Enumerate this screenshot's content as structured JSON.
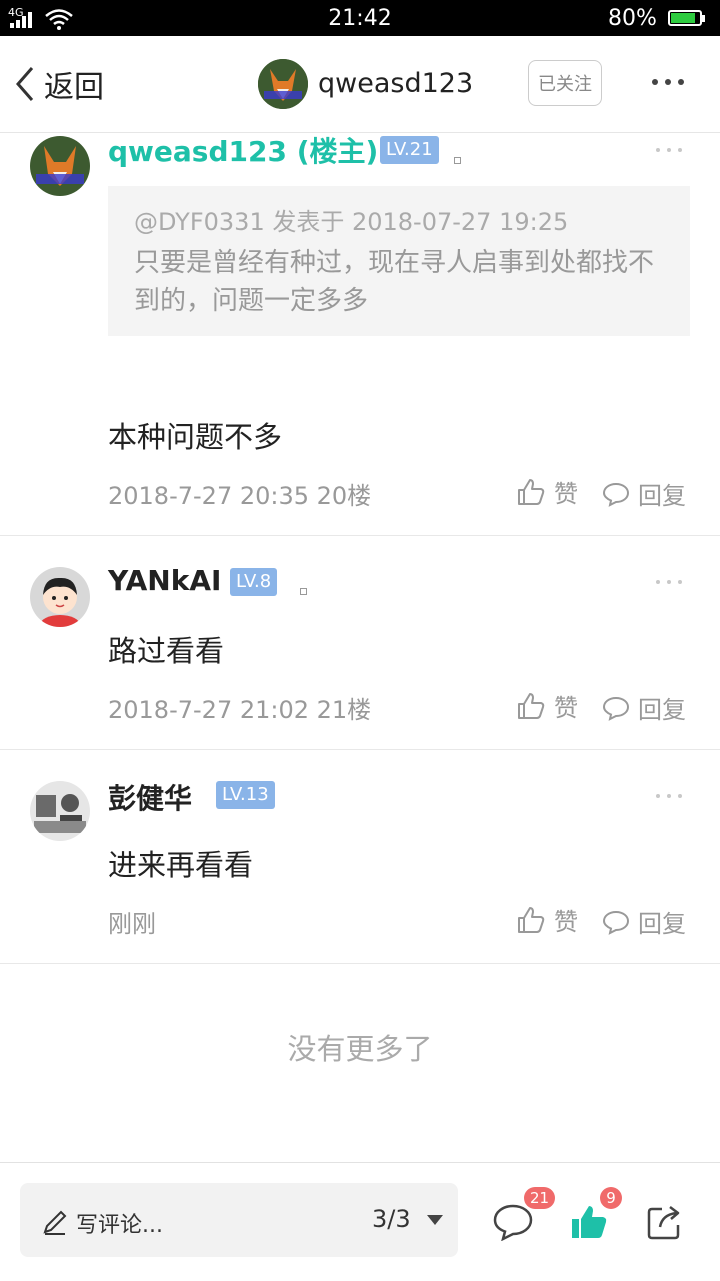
{
  "status_bar": {
    "network": "4G",
    "time": "21:42",
    "battery": "80%"
  },
  "header": {
    "back_label": "返回",
    "username": "qweasd123",
    "follow_label": "已关注"
  },
  "comments": [
    {
      "name": "qweasd123 (楼主)",
      "level": "LV.21",
      "quote_meta": "@DYF0331 发表于 2018-07-27 19:25",
      "quote_text": "只要是曾经有种过，现在寻人启事到处都找不到的，问题一定多多",
      "text": "本种问题不多",
      "meta": "2018-7-27 20:35  20楼",
      "like_label": "赞",
      "reply_label": "回复"
    },
    {
      "name": "YANkAI",
      "level": "LV.8",
      "text": "路过看看",
      "meta": "2018-7-27 21:02  21楼",
      "like_label": "赞",
      "reply_label": "回复"
    },
    {
      "name": "彭健华",
      "level": "LV.13",
      "text": "进来再看看",
      "meta": "刚刚",
      "like_label": "赞",
      "reply_label": "回复"
    }
  ],
  "no_more": "没有更多了",
  "bottom_bar": {
    "write_label": "写评论...",
    "page_indicator": "3/3",
    "comment_count": "21",
    "like_count": "9"
  },
  "colors": {
    "accent": "#1ec0a8",
    "level_badge": "#8ab4e8",
    "count_badge": "#f06a6a"
  }
}
